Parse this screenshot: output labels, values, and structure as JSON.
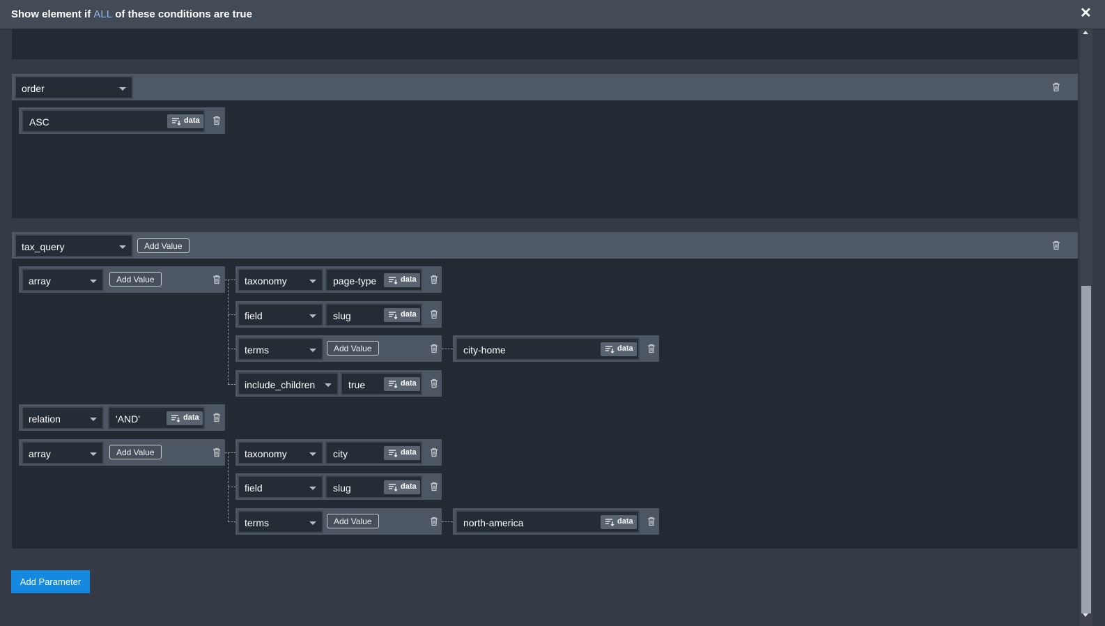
{
  "modal": {
    "title_prefix": "Show element if ",
    "title_all": "ALL",
    "title_suffix": " of these conditions are true",
    "close_glyph": "✕"
  },
  "params": {
    "order": {
      "key": "order",
      "value": "ASC"
    },
    "tax_query": {
      "key": "tax_query",
      "add_value": "Add Value",
      "array1": {
        "key": "array",
        "add_value": "Add Value",
        "taxonomy_key": "taxonomy",
        "taxonomy_value": "page-type",
        "field_key": "field",
        "field_value": "slug",
        "terms_key": "terms",
        "terms_add_value": "Add Value",
        "terms_item": "city-home",
        "include_key": "include_children",
        "include_value": "true"
      },
      "relation": {
        "key": "relation",
        "value": "'AND'"
      },
      "array2": {
        "key": "array",
        "add_value": "Add Value",
        "taxonomy_key": "taxonomy",
        "taxonomy_value": "city",
        "field_key": "field",
        "field_value": "slug",
        "terms_key": "terms",
        "terms_add_value": "Add Value",
        "terms_item": "north-america"
      }
    }
  },
  "data_label": "data",
  "add_parameter": "Add Parameter",
  "icons": {
    "trash": "trash-icon",
    "data": "data-list-icon",
    "caret": "chevron-down-icon"
  }
}
